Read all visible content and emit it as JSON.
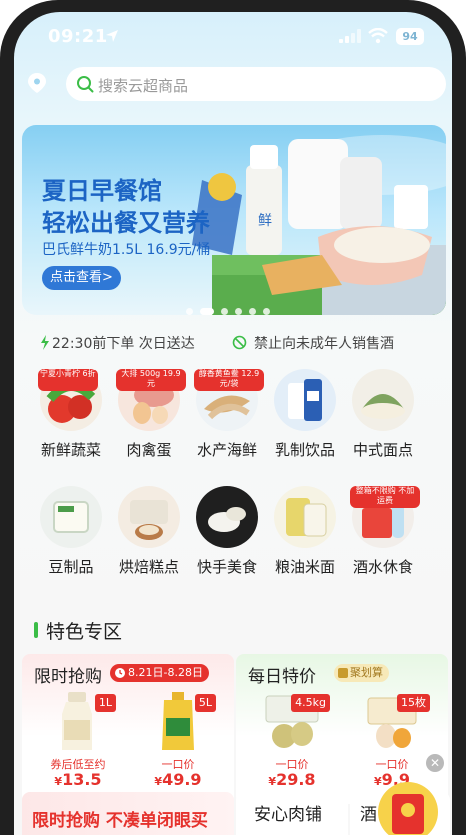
{
  "status_bar": {
    "time": "09:21",
    "battery": "94"
  },
  "search": {
    "placeholder": "搜索云超商品"
  },
  "banner": {
    "title_line1": "夏日早餐馆",
    "title_line2": "轻松出餐又营养",
    "subtitle": "巴氏鲜牛奶1.5L 16.9元/桶",
    "cta": "点击查看>",
    "pages": 6,
    "active_page": 1
  },
  "notice": {
    "delivery": "22:30前下单 次日送达",
    "restriction": "禁止向未成年人销售酒"
  },
  "categories": [
    {
      "label": "鲜蔬菜",
      "label_full": "新鲜蔬菜",
      "tag": "宁夏小青柠 6折",
      "icon": "vegetables-icon"
    },
    {
      "label": "肉禽蛋",
      "tag": "大排 500g 19.9元",
      "icon": "meat-egg-icon"
    },
    {
      "label": "水产海鲜",
      "tag": "醇香黄鱼鲞 12.9元/袋",
      "icon": "seafood-icon"
    },
    {
      "label": "乳制饮品",
      "tag": "",
      "icon": "milk-icon"
    },
    {
      "label": "中式面点",
      "tag": "",
      "icon": "dumpling-icon"
    },
    {
      "label": "豆制品",
      "tag": "",
      "icon": "tofu-icon"
    },
    {
      "label": "烘焙糕点",
      "tag": "",
      "icon": "bakery-icon"
    },
    {
      "label": "快手美食",
      "tag": "",
      "icon": "quick-food-icon"
    },
    {
      "label": "粮油米面",
      "tag": "",
      "icon": "grain-oil-icon"
    },
    {
      "label": "酒水休食",
      "tag": "整箱不限购 不加运费",
      "icon": "drinks-icon"
    }
  ],
  "featured": {
    "title": "特色专区",
    "flash_sale": {
      "title": "限时抢购",
      "dates": "8.21日-8.28日",
      "products": [
        {
          "badge": "1L",
          "note": "券后低至约",
          "price": "13.5",
          "icon": "milk-bottle-icon"
        },
        {
          "badge": "5L",
          "note": "一口价",
          "price": "49.9",
          "icon": "oil-bottle-icon"
        }
      ]
    },
    "daily_special": {
      "title": "每日特价",
      "tag": "聚划算",
      "products": [
        {
          "badge": "4.5kg",
          "note": "一口价",
          "price": "29.8",
          "icon": "pear-box-icon"
        },
        {
          "badge": "15枚",
          "note": "一口价",
          "price": "9.9",
          "icon": "egg-box-icon"
        }
      ]
    },
    "bottom": {
      "promo": "限时抢购 不凑单闭眼买",
      "meat": "安心肉铺",
      "wine": "酒"
    }
  },
  "colors": {
    "brand_red": "#e5322d",
    "accent_green": "#3bbd47",
    "banner_blue": "#1c64c4"
  }
}
